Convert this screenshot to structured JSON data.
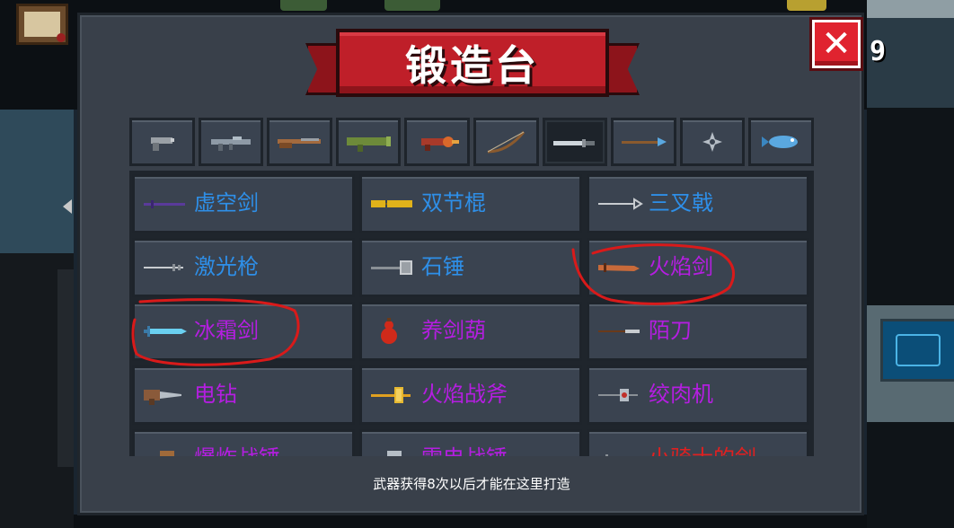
{
  "header": {
    "title": "锻造台",
    "close_label": "✕",
    "gem_count": "9"
  },
  "colors": {
    "blue_name": "#2e8fe8",
    "purple_name": "#b41ee0",
    "red_name": "#e02020",
    "annotation": "#d91a1a"
  },
  "tabs": [
    {
      "icon": "pistol-icon",
      "active": false
    },
    {
      "icon": "assault-rifle-icon",
      "active": false
    },
    {
      "icon": "shotgun-icon",
      "active": false
    },
    {
      "icon": "rocket-launcher-icon",
      "active": false
    },
    {
      "icon": "flamethrower-icon",
      "active": false
    },
    {
      "icon": "bow-icon",
      "active": false
    },
    {
      "icon": "sword-icon",
      "active": true
    },
    {
      "icon": "spear-icon",
      "active": false
    },
    {
      "icon": "shuriken-icon",
      "active": false
    },
    {
      "icon": "fish-icon",
      "active": false
    }
  ],
  "weapons": [
    {
      "name": "虚空剑",
      "color": "#2e8fe8",
      "icon": "void-sword-icon",
      "circled": false
    },
    {
      "name": "双节棍",
      "color": "#2e8fe8",
      "icon": "nunchaku-icon",
      "circled": false
    },
    {
      "name": "三叉戟",
      "color": "#2e8fe8",
      "icon": "trident-icon",
      "circled": false
    },
    {
      "name": "激光枪",
      "color": "#2e8fe8",
      "icon": "laser-lance-icon",
      "circled": false
    },
    {
      "name": "石锤",
      "color": "#2e8fe8",
      "icon": "stone-hammer-icon",
      "circled": false
    },
    {
      "name": "火焰剑",
      "color": "#b41ee0",
      "icon": "flame-sword-icon",
      "circled": true
    },
    {
      "name": "冰霜剑",
      "color": "#b41ee0",
      "icon": "frost-sword-icon",
      "circled": true
    },
    {
      "name": "养剑葫",
      "color": "#b41ee0",
      "icon": "gourd-icon",
      "circled": false
    },
    {
      "name": "陌刀",
      "color": "#b41ee0",
      "icon": "mo-blade-icon",
      "circled": false
    },
    {
      "name": "电钻",
      "color": "#b41ee0",
      "icon": "drill-icon",
      "circled": false
    },
    {
      "name": "火焰战斧",
      "color": "#b41ee0",
      "icon": "flame-axe-icon",
      "circled": false
    },
    {
      "name": "绞肉机",
      "color": "#b41ee0",
      "icon": "meat-grinder-icon",
      "circled": false
    },
    {
      "name": "爆炸战锤",
      "color": "#b41ee0",
      "icon": "explosive-hammer-icon",
      "circled": false
    },
    {
      "name": "雷电战锤",
      "color": "#b41ee0",
      "icon": "thunder-hammer-icon",
      "circled": false
    },
    {
      "name": "小骑士的剑",
      "color": "#e02020",
      "icon": "little-knight-sword-icon",
      "circled": false
    }
  ],
  "footer": {
    "hint": "武器获得8次以后才能在这里打造"
  }
}
